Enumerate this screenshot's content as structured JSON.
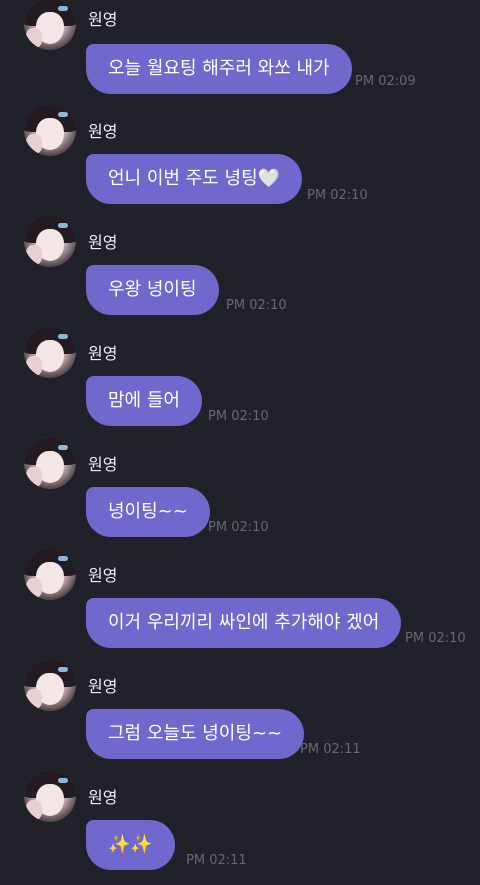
{
  "messages": [
    {
      "sender": "원영",
      "text": "오늘 월요팅 해주러 와쏘 내가",
      "time": "PM 02:09"
    },
    {
      "sender": "원영",
      "text": "언니 이번 주도 녕팅🤍",
      "time": "PM 02:10"
    },
    {
      "sender": "원영",
      "text": "우왕 녕이팅",
      "time": "PM 02:10"
    },
    {
      "sender": "원영",
      "text": "맘에 들어",
      "time": "PM 02:10"
    },
    {
      "sender": "원영",
      "text": "녕이팅~~",
      "time": "PM 02:10"
    },
    {
      "sender": "원영",
      "text": "이거 우리끼리 싸인에 추가해야 겠어",
      "time": "PM 02:10"
    },
    {
      "sender": "원영",
      "text": "그럼 오늘도 녕이팅~~",
      "time": "PM 02:11"
    },
    {
      "sender": "원영",
      "text": "✨✨",
      "time": "PM 02:11"
    }
  ],
  "colors": {
    "background": "#212129",
    "bubble": "#7068cc",
    "name_text": "#eeeef2",
    "time_text": "#676773"
  },
  "icons": {
    "avatar": "profile-photo-icon"
  }
}
